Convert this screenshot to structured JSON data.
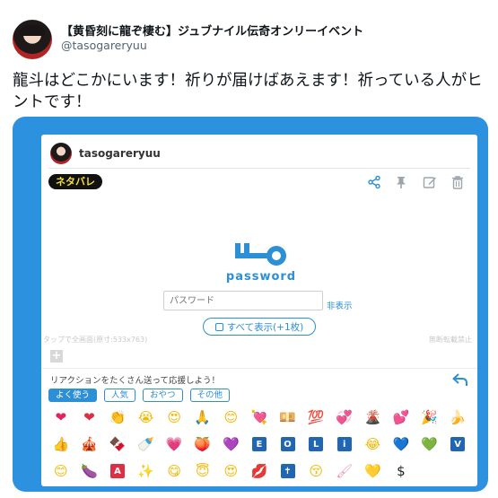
{
  "tweet": {
    "display_name": "【黄昏刻に龍ぞ棲む】ジュブナイル伝奇オンリーイベント",
    "handle": "@tasogareryuu",
    "text": "龍斗はどこかにいます！祈りが届けばあえます！祈っている人がヒントです！"
  },
  "card": {
    "username": "tasogareryuu",
    "spoiler_badge": "ネタバレ",
    "toolbar_icons": [
      "share-icon",
      "pin-icon",
      "edit-icon",
      "trash-icon"
    ],
    "password_title": "password",
    "password_placeholder": "パスワード",
    "password_hide_link": "非表示",
    "show_all_label": "すべて表示(+1枚)",
    "faint_left_text": "タップで全画面(原寸:533x763)",
    "faint_right_text": "無断転載禁止",
    "reaction_prompt": "リアクションをたくさん送って応援しよう！",
    "tabs": [
      {
        "label": "よく使う",
        "active": true
      },
      {
        "label": "人気",
        "active": false
      },
      {
        "label": "おやつ",
        "active": false
      },
      {
        "label": "その他",
        "active": false
      }
    ],
    "emojis": [
      {
        "g": "❤",
        "c": "#e0245e"
      },
      {
        "g": "❤",
        "c": "#dd2e44"
      },
      {
        "g": "👏",
        "c": "#f5b800"
      },
      {
        "g": "😭",
        "c": "#f5b800"
      },
      {
        "g": "😍",
        "c": "#f5b800"
      },
      {
        "g": "🙏",
        "c": "#f5b800"
      },
      {
        "g": "😊",
        "c": "#f5b800"
      },
      {
        "g": "💘",
        "c": "#e0245e"
      },
      {
        "g": "💴",
        "c": "#e0a800"
      },
      {
        "g": "💯",
        "c": "#dd2e44"
      },
      {
        "g": "💞",
        "c": "#e0245e"
      },
      {
        "g": "🌋",
        "c": "#8a5a44"
      },
      {
        "g": "💕",
        "c": "#e0245e"
      },
      {
        "g": "🎉",
        "c": "#f5b800"
      },
      {
        "g": "🍌",
        "c": "#f5c400"
      },
      {
        "g": "👍",
        "c": "#f5b800"
      },
      {
        "g": "🎪",
        "c": "#dd2e44"
      },
      {
        "g": "🍫",
        "c": "#6b3f2a"
      },
      {
        "g": "🍼",
        "c": "#8fb8de"
      },
      {
        "g": "💗",
        "c": "#e0245e"
      },
      {
        "g": "🍑",
        "c": "#f08a5d"
      },
      {
        "g": "💜",
        "c": "#9b59b6"
      },
      {
        "g": "E",
        "c": "#2066b0",
        "box": true
      },
      {
        "g": "O",
        "c": "#2066b0",
        "box": true
      },
      {
        "g": "L",
        "c": "#2066b0",
        "box": true
      },
      {
        "g": "i",
        "c": "#2066b0",
        "box": true
      },
      {
        "g": "😂",
        "c": "#f5b800"
      },
      {
        "g": "💙",
        "c": "#2d8fd5"
      },
      {
        "g": "💚",
        "c": "#3aa845"
      },
      {
        "g": "V",
        "c": "#2066b0",
        "box": true
      },
      {
        "g": "😊",
        "c": "#f5b800"
      },
      {
        "g": "🍆",
        "c": "#7b3f9e"
      },
      {
        "g": "A",
        "c": "#dd2e44",
        "box": true
      },
      {
        "g": "✨",
        "c": "#f5c400"
      },
      {
        "g": "😋",
        "c": "#f5b800"
      },
      {
        "g": "😇",
        "c": "#f5b800"
      },
      {
        "g": "😍",
        "c": "#f5b800"
      },
      {
        "g": "💋",
        "c": "#dd2e44"
      },
      {
        "g": "✝",
        "c": "#2066b0",
        "box": true
      },
      {
        "g": "😚",
        "c": "#f5b800"
      },
      {
        "g": "🖌",
        "c": "#e8a0b0"
      },
      {
        "g": "💛",
        "c": "#f5c400"
      },
      {
        "g": "$",
        "c": "#222"
      }
    ]
  }
}
